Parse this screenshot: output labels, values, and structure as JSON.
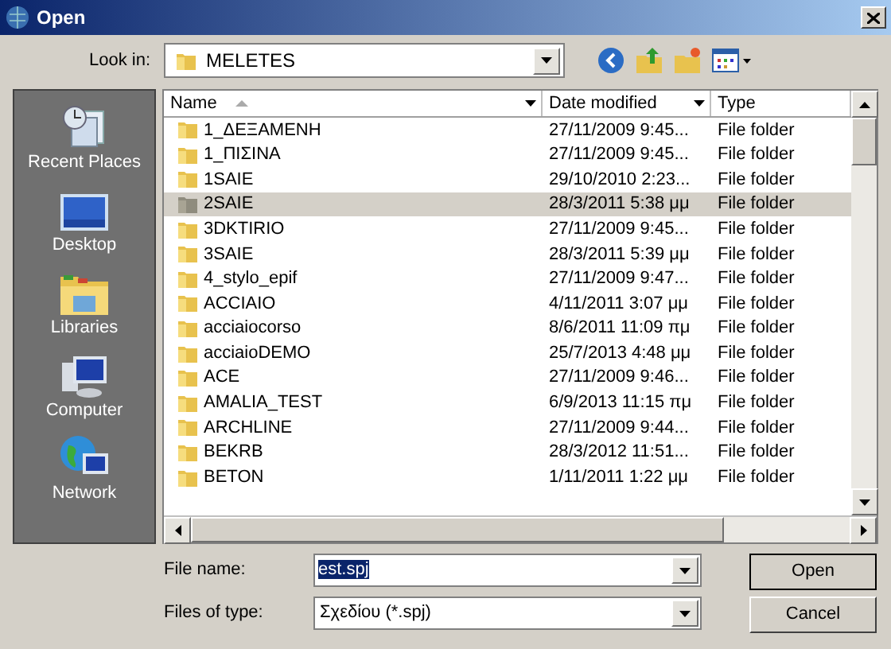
{
  "window": {
    "title": "Open"
  },
  "look_in": {
    "label": "Look in:",
    "value": "MELETES"
  },
  "places": [
    {
      "label": "Recent Places",
      "kind": "recent"
    },
    {
      "label": "Desktop",
      "kind": "desktop"
    },
    {
      "label": "Libraries",
      "kind": "libraries"
    },
    {
      "label": "Computer",
      "kind": "computer"
    },
    {
      "label": "Network",
      "kind": "network"
    }
  ],
  "table": {
    "columns": [
      "Name",
      "Date modified",
      "Type"
    ],
    "rows": [
      {
        "name": "1_ΔΕΞΑΜΕΝΗ",
        "date": "27/11/2009 9:45...",
        "type": "File folder",
        "selected": false
      },
      {
        "name": "1_ΠΙΣΙΝΑ",
        "date": "27/11/2009 9:45...",
        "type": "File folder",
        "selected": false
      },
      {
        "name": "1SAIE",
        "date": "29/10/2010 2:23...",
        "type": "File folder",
        "selected": false
      },
      {
        "name": "2SAIE",
        "date": "28/3/2011 5:38 μμ",
        "type": "File folder",
        "selected": true
      },
      {
        "name": "3DKTIRIO",
        "date": "27/11/2009 9:45...",
        "type": "File folder",
        "selected": false
      },
      {
        "name": "3SAIE",
        "date": "28/3/2011 5:39 μμ",
        "type": "File folder",
        "selected": false
      },
      {
        "name": "4_stylo_epif",
        "date": "27/11/2009 9:47...",
        "type": "File folder",
        "selected": false
      },
      {
        "name": "ACCIAIO",
        "date": "4/11/2011 3:07 μμ",
        "type": "File folder",
        "selected": false
      },
      {
        "name": "acciaiocorso",
        "date": "8/6/2011 11:09 πμ",
        "type": "File folder",
        "selected": false
      },
      {
        "name": "acciaioDEMO",
        "date": "25/7/2013 4:48 μμ",
        "type": "File folder",
        "selected": false
      },
      {
        "name": "ACE",
        "date": "27/11/2009 9:46...",
        "type": "File folder",
        "selected": false
      },
      {
        "name": "AMALIA_TEST",
        "date": "6/9/2013 11:15 πμ",
        "type": "File folder",
        "selected": false
      },
      {
        "name": "ARCHLINE",
        "date": "27/11/2009 9:44...",
        "type": "File folder",
        "selected": false
      },
      {
        "name": "BEKRB",
        "date": "28/3/2012 11:51...",
        "type": "File folder",
        "selected": false
      },
      {
        "name": "BETON",
        "date": "1/11/2011 1:22 μμ",
        "type": "File folder",
        "selected": false
      }
    ]
  },
  "file_name": {
    "label": "File name:",
    "value": "est.spj"
  },
  "file_type": {
    "label": "Files of type:",
    "value": "Σχεδίου (*.spj)"
  },
  "buttons": [
    "Open",
    "Cancel"
  ]
}
